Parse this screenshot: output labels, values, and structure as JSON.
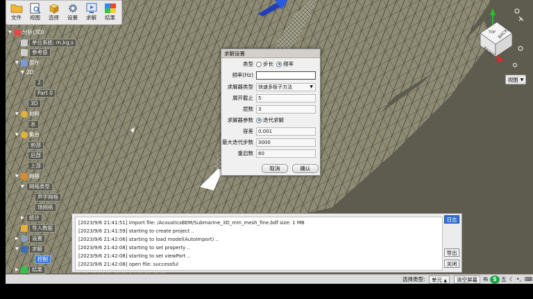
{
  "toolbar": {
    "items": [
      {
        "label": "文件",
        "icon": "folder-icon"
      },
      {
        "label": "视图",
        "icon": "view-icon"
      },
      {
        "label": "选择",
        "icon": "select-cube-icon"
      },
      {
        "label": "设置",
        "icon": "gear-icon"
      },
      {
        "label": "求解",
        "icon": "solve-icon"
      },
      {
        "label": "结果",
        "icon": "result-icon"
      }
    ]
  },
  "tree": {
    "root": "分析(3D)",
    "unit_system": "单位系统: m,kg,s",
    "reference": "参考值",
    "parts": "部件",
    "part_2d": "2D",
    "part_2": "2",
    "part_0": "Part 0",
    "part_3d": "3D",
    "material": "材料",
    "water": "水",
    "collection": "集合",
    "front": "前部",
    "back": "后部",
    "top": "上部",
    "mesh": "网格",
    "mesh_type": "网格类型",
    "acoustic_mesh": "声学网格",
    "field_mesh": "场网格",
    "statistics": "统计",
    "import_data": "导入数据",
    "settings": "设置",
    "solve": "求解",
    "control": "控制",
    "result": "结果"
  },
  "view_button": "视图",
  "dialog": {
    "title": "求解设置",
    "type_label": "类型",
    "type_step": "步长",
    "type_freq": "频率",
    "freq_label": "频率(Hz)",
    "freq_value": "",
    "solver_type_label": "求解器类型",
    "solver_type_value": "快速多极子方法",
    "expand_label": "展开截止",
    "expand_value": "5",
    "levels_label": "层数",
    "levels_value": "3",
    "solver_param_label": "求解器参数",
    "solver_param_value": "迭代求解",
    "tol_label": "容差",
    "tol_value": "0.001",
    "maxiter_label": "最大迭代步数",
    "maxiter_value": "3000",
    "restart_label": "重启数",
    "restart_value": "60",
    "cancel": "取消",
    "ok": "确认"
  },
  "log": {
    "lines": [
      "[2023/9/6 21:41:51] import file: /AcousticsBEM/Submarine_3D_mm_mesh_fine.bdf size: 1 MB",
      "[2023/9/6 21:41:59] starting to create project ..",
      "[2023/9/6 21:42:06] starting to load model(AutoImport) ..",
      "[2023/9/6 21:42:08] starting to set property ..",
      "[2023/9/6 21:42:08] starting to set viewPort ..",
      "[2023/9/6 21:42:08] open file: successful"
    ],
    "btn_log": "日志",
    "btn_export": "导出",
    "btn_close": "关闭"
  },
  "status": {
    "select_type_label": "选择类型:",
    "select_type_value": "单元",
    "clear_screen": "清空屏幕",
    "layout": "布",
    "ime": "五"
  },
  "colors": {
    "mesh_fill": "#8c8a74",
    "background": "#5e5b4f",
    "accent_blue": "#2f6fd0"
  }
}
